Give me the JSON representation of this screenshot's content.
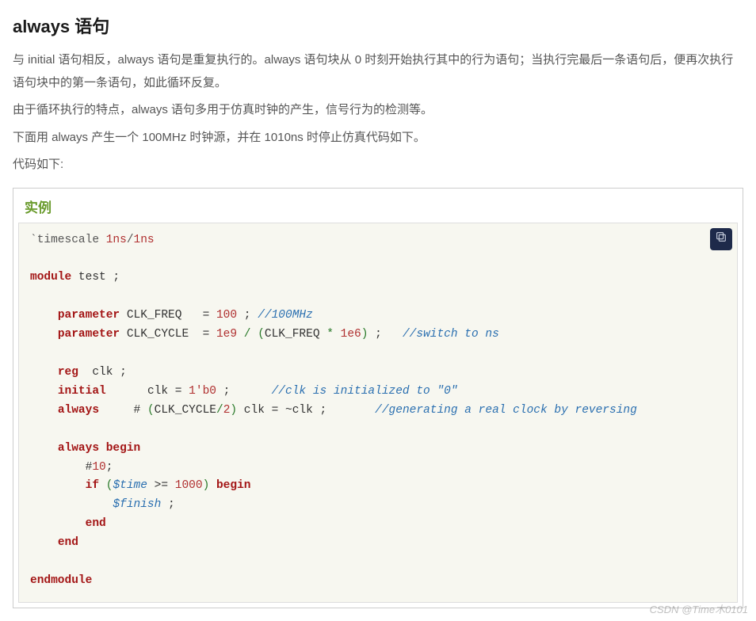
{
  "heading": "always 语句",
  "paragraphs": [
    "与 initial 语句相反，always 语句是重复执行的。always 语句块从 0 时刻开始执行其中的行为语句；当执行完最后一条语句后，便再次执行语句块中的第一条语句，如此循环反复。",
    "由于循环执行的特点，always 语句多用于仿真时钟的产生，信号行为的检测等。",
    "下面用 always 产生一个 100MHz 时钟源，并在 1010ns 时停止仿真代码如下。",
    "代码如下:"
  ],
  "example_label": "实例",
  "watermark": "CSDN @Time木0101",
  "code": {
    "timescale_directive": "`timescale",
    "timescale_a": "1ns",
    "timescale_sep": "/",
    "timescale_b": "1ns",
    "kw_module": "module",
    "mod_name": "test",
    "kw_parameter": "parameter",
    "param1_name": "CLK_FREQ",
    "param1_val": "100",
    "param1_comment": "//100MHz",
    "param2_name": "CLK_CYCLE",
    "param2_expr_a": "1e9",
    "param2_expr_b": "CLK_FREQ",
    "param2_expr_c": "1e6",
    "param2_comment": "//switch to ns",
    "kw_reg": "reg",
    "reg_name": "clk",
    "kw_initial": "initial",
    "init_lhs": "clk",
    "init_rhs": "1'b0",
    "init_comment": "//clk is initialized to \"0\"",
    "kw_always": "always",
    "always_delay_expr": "CLK_CYCLE",
    "always_delay_div": "2",
    "always_lhs": "clk",
    "always_rhs": "clk",
    "always_comment": "//generating a real clock by reversing",
    "kw_begin": "begin",
    "kw_end": "end",
    "delay10": "10",
    "kw_if": "if",
    "sys_time": "$time",
    "cmp_val": "1000",
    "sys_finish": "$finish",
    "kw_endmodule": "endmodule"
  }
}
